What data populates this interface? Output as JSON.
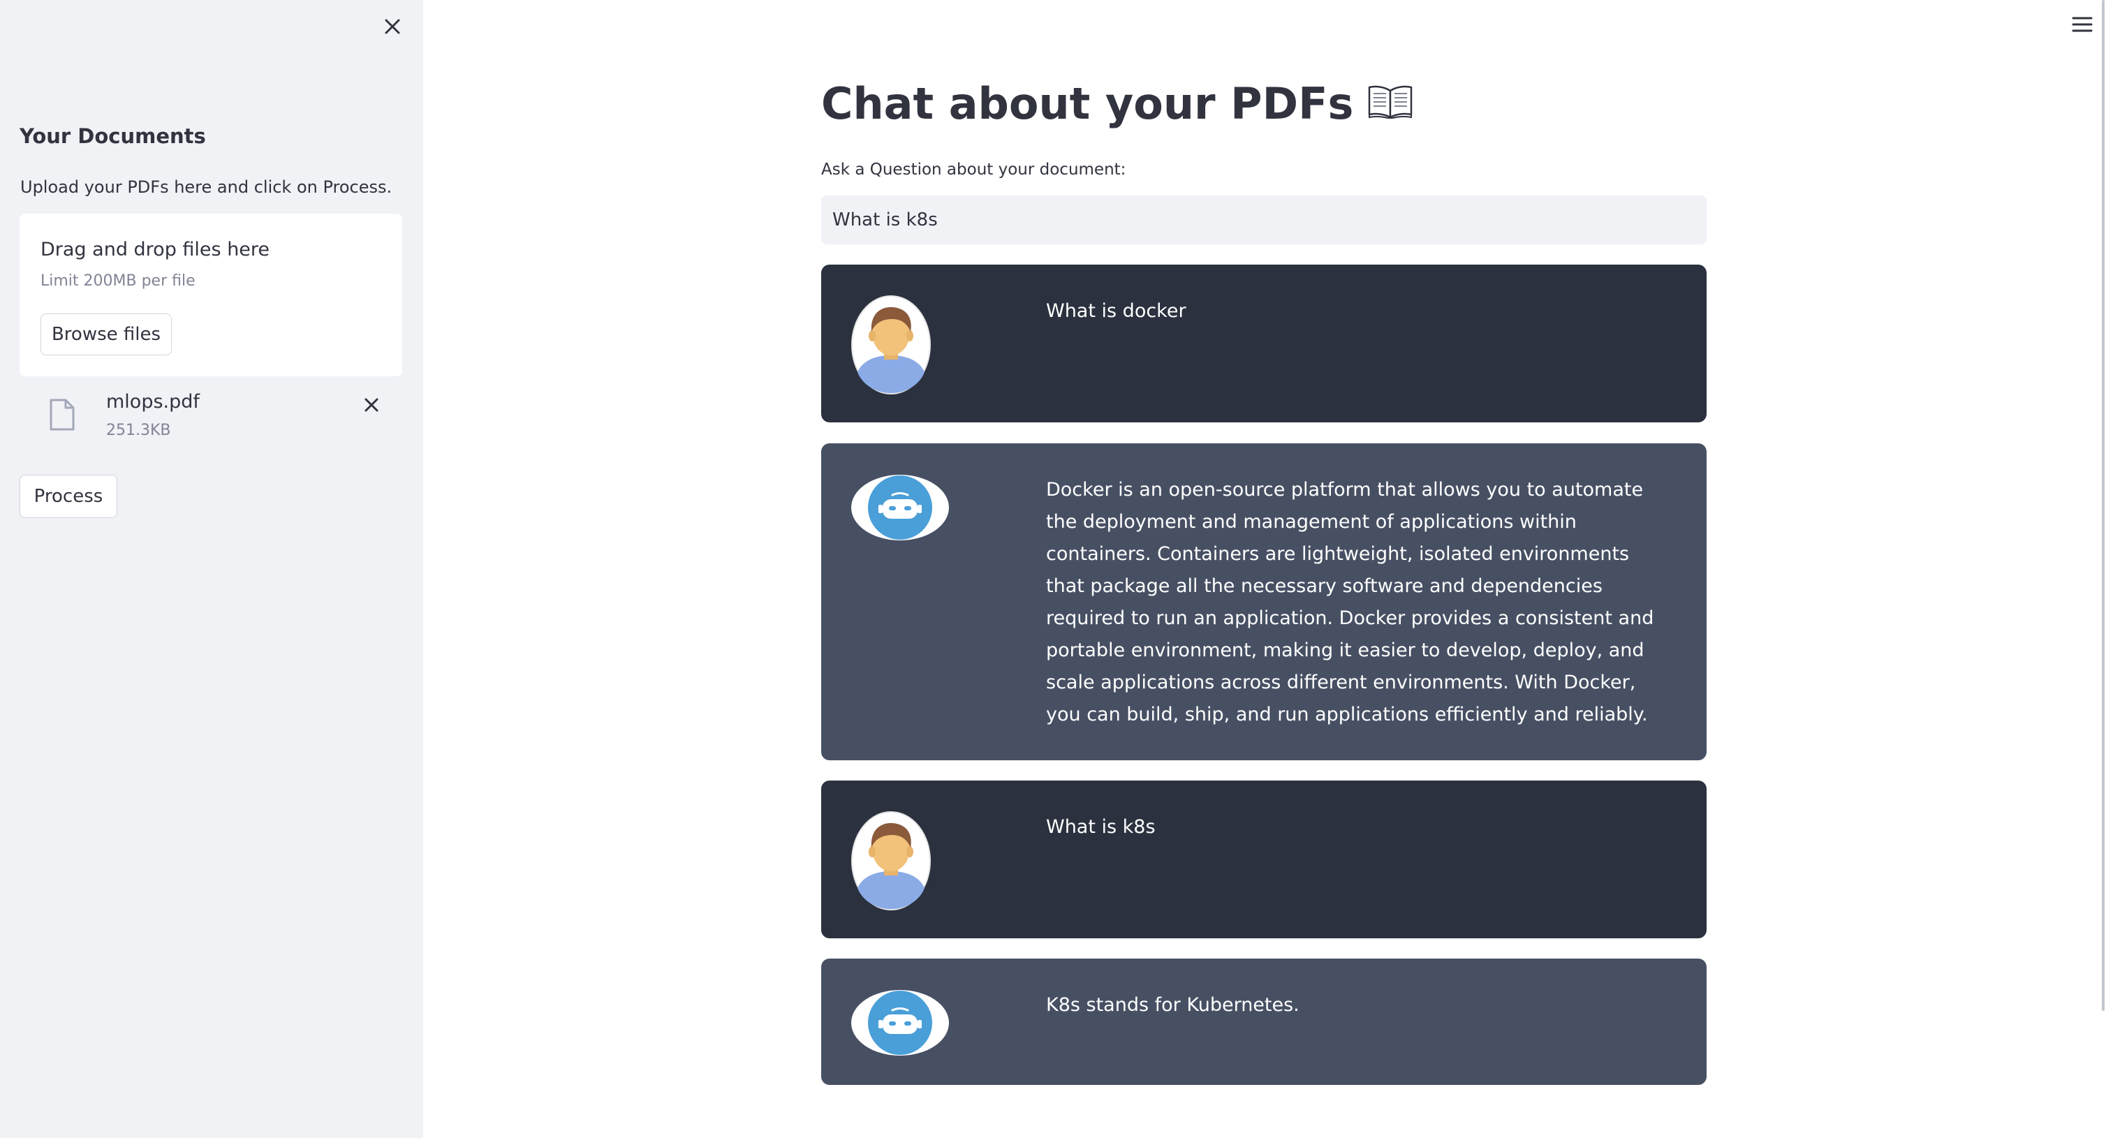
{
  "sidebar": {
    "heading": "Your Documents",
    "subtitle": "Upload your PDFs here and click on Process.",
    "uploader": {
      "title": "Drag and drop files here",
      "limit": "Limit 200MB per file",
      "browse_label": "Browse files"
    },
    "file": {
      "name": "mlops.pdf",
      "size": "251.3KB"
    },
    "process_label": "Process"
  },
  "main": {
    "title": "Chat about your PDFs",
    "title_icon": "open-book-icon",
    "question_label": "Ask a Question about your document:",
    "question_value": "What is k8s",
    "messages": [
      {
        "role": "user",
        "avatar": "user-avatar-icon",
        "text": "What is docker"
      },
      {
        "role": "bot",
        "avatar": "bot-avatar-icon",
        "text": "Docker is an open-source platform that allows you to automate the deployment and management of applications within containers. Containers are lightweight, isolated environments that package all the necessary software and dependencies required to run an application. Docker provides a consistent and portable environment, making it easier to develop, deploy, and scale applications across different environments. With Docker, you can build, ship, and run applications efficiently and reliably."
      },
      {
        "role": "user",
        "avatar": "user-avatar-icon",
        "text": "What is k8s"
      },
      {
        "role": "bot",
        "avatar": "bot-avatar-icon",
        "text": "K8s stands for Kubernetes."
      }
    ]
  },
  "colors": {
    "sidebar_bg": "#f0f2f6",
    "user_message_bg": "#2b313e",
    "bot_message_bg": "#475063",
    "text": "#31333f",
    "muted_text": "#808495",
    "bot_avatar_blue": "#4a9fd8"
  },
  "icons": {
    "close_sidebar": "close-icon",
    "remove_file": "close-icon",
    "file": "file-icon",
    "menu": "hamburger-menu-icon"
  }
}
